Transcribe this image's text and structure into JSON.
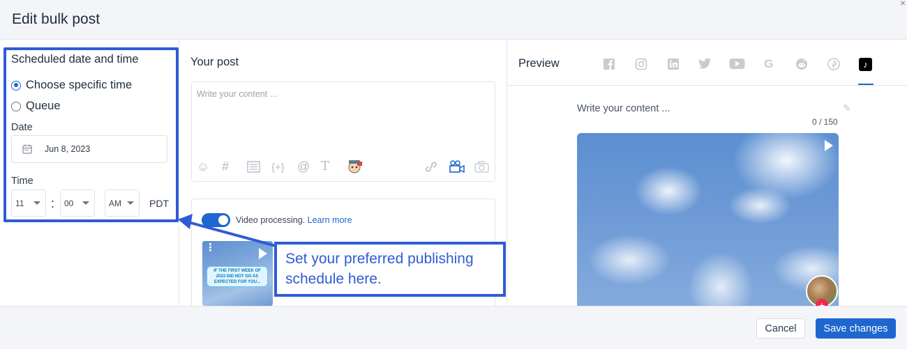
{
  "header": {
    "title": "Edit bulk post",
    "close_icon": "close-icon"
  },
  "schedule": {
    "title": "Scheduled date and time",
    "options": [
      {
        "label": "Choose specific time",
        "selected": true
      },
      {
        "label": "Queue",
        "selected": false
      }
    ],
    "date_label": "Date",
    "date_value": "Jun 8, 2023",
    "time_label": "Time",
    "hour": "11",
    "minute": "00",
    "ampm": "AM",
    "timezone": "PDT"
  },
  "post": {
    "title": "Your post",
    "placeholder": "Write your content ...",
    "tools_left": [
      "emoji-icon",
      "hashtag-icon",
      "template-icon",
      "variable-icon",
      "mention-icon",
      "text-format-icon",
      "ai-assistant-icon"
    ],
    "tools_right": [
      "link-icon",
      "video-icon",
      "camera-icon"
    ],
    "video_processing_text": "Video processing.",
    "learn_more": "Learn more",
    "video_processing_on": true,
    "thumb_caption": "IF THE FIRST WEEK OF 2023 DID NOT GO AS EXPECTED FOR YOU..."
  },
  "callout": {
    "text": "Set your preferred publishing schedule here."
  },
  "preview": {
    "title": "Preview",
    "networks": [
      "facebook-icon",
      "instagram-icon",
      "linkedin-icon",
      "twitter-icon",
      "youtube-icon",
      "google-icon",
      "reddit-icon",
      "pinterest-icon",
      "tiktok-icon"
    ],
    "active_network": "tiktok-icon",
    "placeholder": "Write your content ...",
    "counter": "0 / 150"
  },
  "footer": {
    "cancel_label": "Cancel",
    "save_label": "Save changes"
  },
  "colors": {
    "accent": "#1e66d0",
    "annotation": "#2f5bd6"
  }
}
